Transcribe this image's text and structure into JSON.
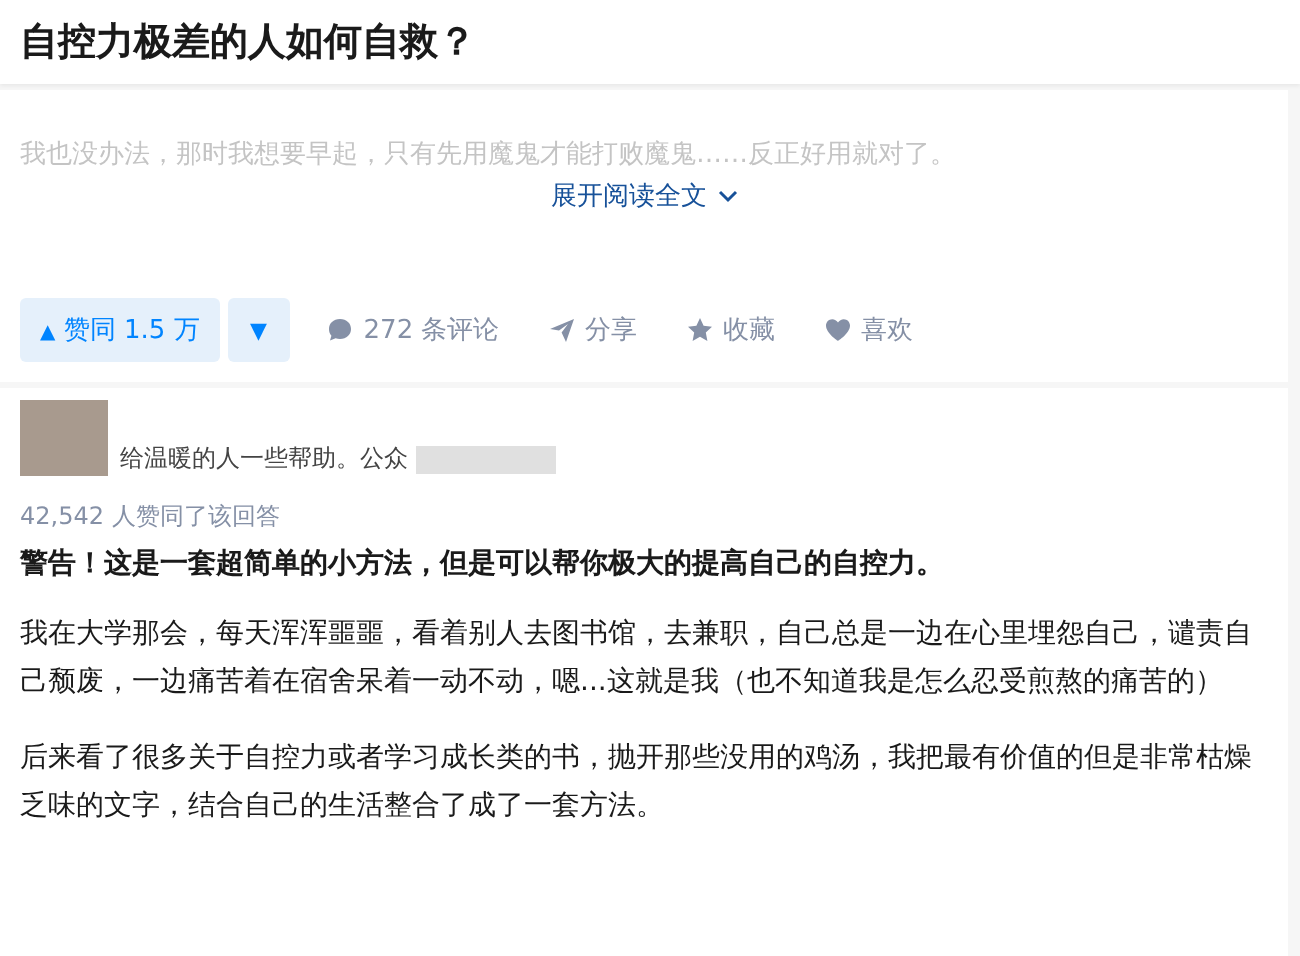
{
  "question": {
    "title": "自控力极差的人如何自救？"
  },
  "excerpt": {
    "text": "我也没办法，那时我想要早起，只有先用魔鬼才能打败魔鬼……反正好用就对了。",
    "expand": "展开阅读全文"
  },
  "actions": {
    "upvote": "赞同 1.5 万",
    "downvote": "▼",
    "upvote_icon": "▲",
    "items": [
      {
        "kind": "comment",
        "label": "272 条评论"
      },
      {
        "kind": "share",
        "label": "分享"
      },
      {
        "kind": "favorite",
        "label": "收藏"
      },
      {
        "kind": "like",
        "label": "喜欢"
      }
    ]
  },
  "author": {
    "bio": "给温暖的人一些帮助。公众"
  },
  "answer": {
    "votes": "42,542 人赞同了该回答",
    "headline": "警告！这是一套超简单的小方法，但是可以帮你极大的提高自己的自控力。",
    "paragraphs": [
      "我在大学那会，每天浑浑噩噩，看着别人去图书馆，去兼职，自己总是一边在心里埋怨自己，谴责自己颓废，一边痛苦着在宿舍呆着一动不动，嗯...这就是我（也不知道我是怎么忍受煎熬的痛苦的）",
      "后来看了很多关于自控力或者学习成长类的书，抛开那些没用的鸡汤，我把最有价值的但是非常枯燥乏味的文字，结合自己的生活整合了成了一套方法。"
    ]
  }
}
